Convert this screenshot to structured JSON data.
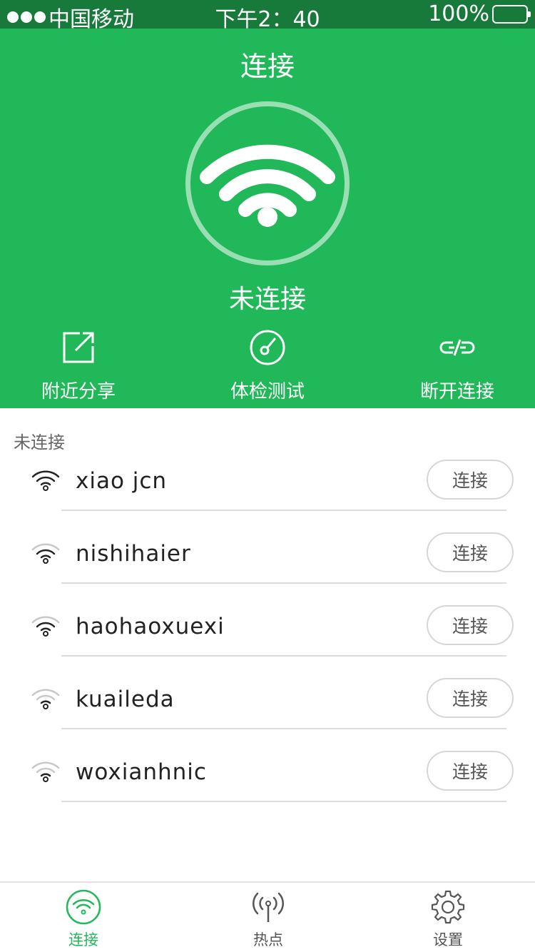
{
  "status_bar": {
    "carrier": "中国移动",
    "time": "下午2：40",
    "battery": "100%"
  },
  "header": {
    "title": "连接",
    "connection_status": "未连接",
    "actions": [
      {
        "label": "附近分享",
        "icon": "share-icon"
      },
      {
        "label": "体检测试",
        "icon": "speedometer-icon"
      },
      {
        "label": "断开连接",
        "icon": "unlink-icon"
      }
    ]
  },
  "list": {
    "section_label": "未连接",
    "networks": [
      {
        "ssid": "xiao jcn",
        "button": "连接",
        "signal": 3
      },
      {
        "ssid": "nishihaier",
        "button": "连接",
        "signal": 2
      },
      {
        "ssid": "haohaoxuexi",
        "button": "连接",
        "signal": 2
      },
      {
        "ssid": "kuaileda",
        "button": "连接",
        "signal": 1
      },
      {
        "ssid": "woxianhnic",
        "button": "连接",
        "signal": 1
      }
    ]
  },
  "tab_bar": {
    "tabs": [
      {
        "label": "连接",
        "icon": "wifi-icon",
        "active": true
      },
      {
        "label": "热点",
        "icon": "hotspot-icon",
        "active": false
      },
      {
        "label": "设置",
        "icon": "gear-icon",
        "active": false
      }
    ]
  },
  "colors": {
    "primary": "#20b858",
    "status_bar": "#187a3a",
    "battery_fill": "#8fcf74"
  }
}
